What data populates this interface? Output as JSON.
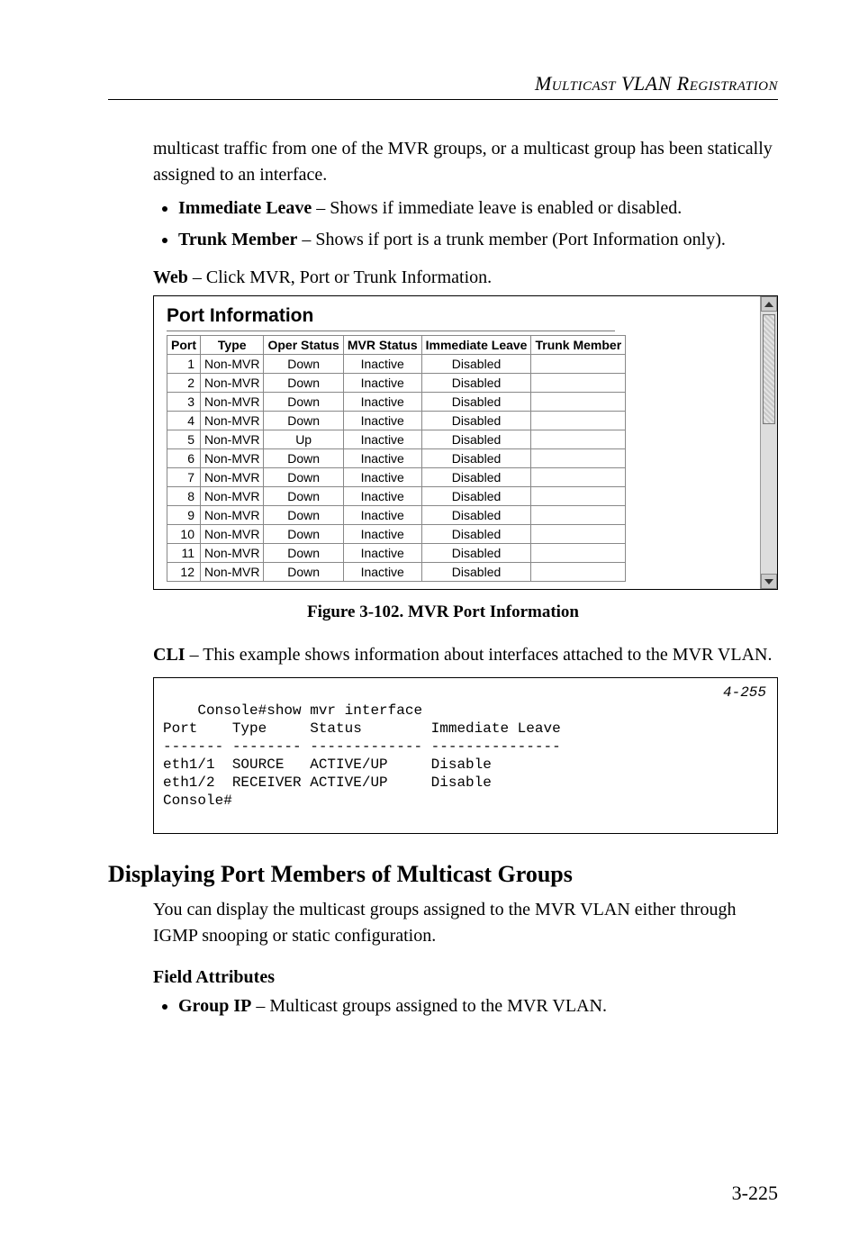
{
  "header": "Multicast VLAN Registration",
  "intro_cont": "multicast traffic from one of the MVR groups, or a multicast group has been statically assigned to an interface.",
  "bullets_top": [
    {
      "term": "Immediate Leave",
      "desc": " – Shows if immediate leave is enabled or disabled."
    },
    {
      "term": "Trunk Member",
      "desc": " – Shows if port is a trunk member (Port Information only)."
    }
  ],
  "web_label": "Web",
  "web_desc": " – Click MVR, Port or Trunk Information.",
  "shot": {
    "title": "Port Information",
    "columns": [
      "Port",
      "Type",
      "Oper Status",
      "MVR Status",
      "Immediate Leave",
      "Trunk Member"
    ],
    "rows": [
      {
        "port": "1",
        "type": "Non-MVR",
        "oper": "Down",
        "mvr": "Inactive",
        "leave": "Disabled",
        "trunk": ""
      },
      {
        "port": "2",
        "type": "Non-MVR",
        "oper": "Down",
        "mvr": "Inactive",
        "leave": "Disabled",
        "trunk": ""
      },
      {
        "port": "3",
        "type": "Non-MVR",
        "oper": "Down",
        "mvr": "Inactive",
        "leave": "Disabled",
        "trunk": ""
      },
      {
        "port": "4",
        "type": "Non-MVR",
        "oper": "Down",
        "mvr": "Inactive",
        "leave": "Disabled",
        "trunk": ""
      },
      {
        "port": "5",
        "type": "Non-MVR",
        "oper": "Up",
        "mvr": "Inactive",
        "leave": "Disabled",
        "trunk": ""
      },
      {
        "port": "6",
        "type": "Non-MVR",
        "oper": "Down",
        "mvr": "Inactive",
        "leave": "Disabled",
        "trunk": ""
      },
      {
        "port": "7",
        "type": "Non-MVR",
        "oper": "Down",
        "mvr": "Inactive",
        "leave": "Disabled",
        "trunk": ""
      },
      {
        "port": "8",
        "type": "Non-MVR",
        "oper": "Down",
        "mvr": "Inactive",
        "leave": "Disabled",
        "trunk": ""
      },
      {
        "port": "9",
        "type": "Non-MVR",
        "oper": "Down",
        "mvr": "Inactive",
        "leave": "Disabled",
        "trunk": ""
      },
      {
        "port": "10",
        "type": "Non-MVR",
        "oper": "Down",
        "mvr": "Inactive",
        "leave": "Disabled",
        "trunk": ""
      },
      {
        "port": "11",
        "type": "Non-MVR",
        "oper": "Down",
        "mvr": "Inactive",
        "leave": "Disabled",
        "trunk": ""
      },
      {
        "port": "12",
        "type": "Non-MVR",
        "oper": "Down",
        "mvr": "Inactive",
        "leave": "Disabled",
        "trunk": ""
      }
    ]
  },
  "figure_caption": "Figure 3-102.  MVR Port Information",
  "cli_label": "CLI",
  "cli_desc": " – This example shows information about interfaces attached to the MVR VLAN.",
  "cli_ref": "4-255",
  "cli_lines": "Console#show mvr interface\nPort    Type     Status        Immediate Leave\n------- -------- ------------- ---------------\neth1/1  SOURCE   ACTIVE/UP     Disable\neth1/2  RECEIVER ACTIVE/UP     Disable\nConsole#",
  "section_title": "Displaying Port Members of Multicast Groups",
  "section_body": "You can display the multicast groups assigned to the MVR VLAN either through IGMP snooping or static configuration.",
  "field_attr_heading": "Field Attributes",
  "bullets_bottom": [
    {
      "term": "Group IP",
      "desc": " – Multicast groups assigned to the MVR VLAN."
    }
  ],
  "page_number": "3-225"
}
